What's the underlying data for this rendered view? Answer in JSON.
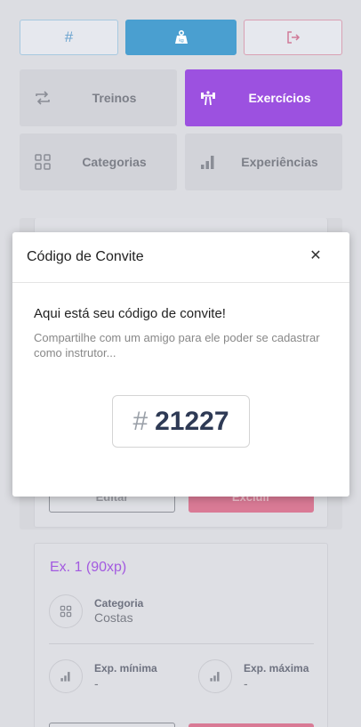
{
  "toolbar": {
    "hash_icon": "hash-icon",
    "hash_glyph": "#",
    "weight_icon": "weight-icon",
    "logout_icon": "logout-icon"
  },
  "nav": {
    "treinos": "Treinos",
    "exercicios": "Exercícios",
    "categorias": "Categorias",
    "experiencias": "Experiências"
  },
  "card0": {
    "edit_label": "Editar",
    "delete_label": "Excluir"
  },
  "card1": {
    "title": "Ex. 1 (90xp)",
    "category_label": "Categoria",
    "category_value": "Costas",
    "exp_min_label": "Exp. mínima",
    "exp_min_value": "-",
    "exp_max_label": "Exp. máxima",
    "exp_max_value": "-"
  },
  "modal": {
    "title": "Código de Convite",
    "close_glyph": "✕",
    "message": "Aqui está seu código de convite!",
    "subtext": "Compartilhe com um amigo para ele poder se cadastrar como instrutor...",
    "code_prefix": "#",
    "code": "21227"
  },
  "colors": {
    "accent_purple": "#9c51e0",
    "accent_blue": "#4a9fd0",
    "danger_pink": "#d97a95"
  }
}
